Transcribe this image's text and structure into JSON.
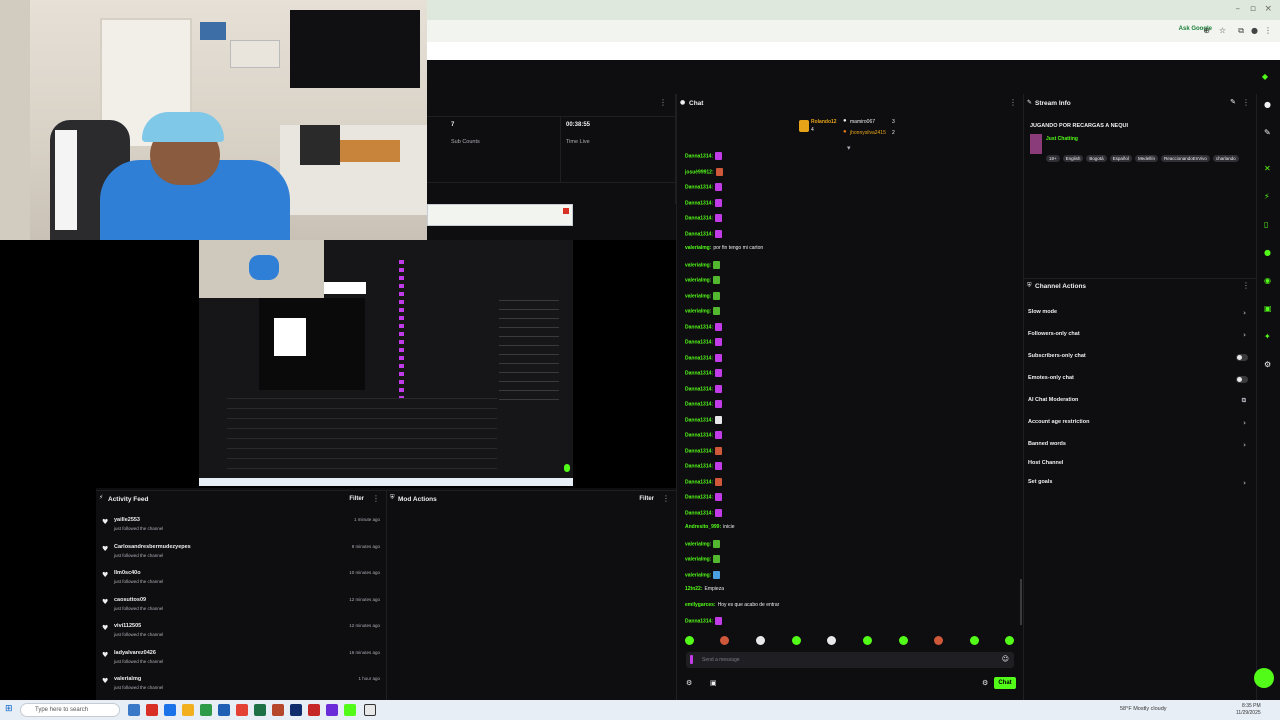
{
  "browser": {
    "ask_google": "Ask Google",
    "window_controls": [
      "–",
      "▫",
      "×"
    ]
  },
  "stats": {
    "sub_count_value": "7",
    "sub_count_label": "Sub Counts",
    "time_live_value": "00:38:55",
    "time_live_label": "Time Live"
  },
  "chat": {
    "title": "Chat",
    "gifters": [
      {
        "name": "Rolando12",
        "count": "4"
      },
      {
        "name": "mamiro067",
        "count": "3"
      },
      {
        "name": "jhonnysilva2415",
        "count": "2"
      }
    ],
    "messages": [
      {
        "user": "Danna1314:",
        "text": "",
        "emote": "e-p"
      },
      {
        "user": "josuè99912:",
        "text": "",
        "emote": "e-o"
      },
      {
        "user": "Danna1314:",
        "text": "",
        "emote": "e-p"
      },
      {
        "user": "Danna1314:",
        "text": "",
        "emote": "e-p"
      },
      {
        "user": "Danna1314:",
        "text": "",
        "emote": "e-p"
      },
      {
        "user": "Danna1314:",
        "text": "",
        "emote": "e-p"
      },
      {
        "user": "valerialmg:",
        "text": "por fin tengo mi carton",
        "emote": ""
      },
      {
        "user": "valerialmg:",
        "text": "",
        "emote": "e-g"
      },
      {
        "user": "valerialmg:",
        "text": "",
        "emote": "e-g"
      },
      {
        "user": "valerialmg:",
        "text": "",
        "emote": "e-g"
      },
      {
        "user": "valerialmg:",
        "text": "",
        "emote": "e-g"
      },
      {
        "user": "Danna1314:",
        "text": "",
        "emote": "e-p"
      },
      {
        "user": "Danna1314:",
        "text": "",
        "emote": "e-p"
      },
      {
        "user": "Danna1314:",
        "text": "",
        "emote": "e-p"
      },
      {
        "user": "Danna1314:",
        "text": "",
        "emote": "e-p"
      },
      {
        "user": "Danna1314:",
        "text": "",
        "emote": "e-p"
      },
      {
        "user": "Danna1314:",
        "text": "",
        "emote": "e-p"
      },
      {
        "user": "Danna1314:",
        "text": "",
        "emote": "e-w"
      },
      {
        "user": "Danna1314:",
        "text": "",
        "emote": "e-p"
      },
      {
        "user": "Danna1314:",
        "text": "",
        "emote": "e-o"
      },
      {
        "user": "Danna1314:",
        "text": "",
        "emote": "e-p"
      },
      {
        "user": "Danna1314:",
        "text": "",
        "emote": "e-o"
      },
      {
        "user": "Danna1314:",
        "text": "",
        "emote": "e-p"
      },
      {
        "user": "Danna1314:",
        "text": "",
        "emote": "e-p"
      },
      {
        "user": "Andresito_999:",
        "text": "inicie",
        "emote": ""
      },
      {
        "user": "valerialmg:",
        "text": "",
        "emote": "e-g"
      },
      {
        "user": "valerialmg:",
        "text": "",
        "emote": "e-g"
      },
      {
        "user": "valerialmg:",
        "text": "",
        "emote": "e-b"
      },
      {
        "user": "12tn22:",
        "text": "Empieza",
        "emote": ""
      },
      {
        "user": "emilygarces:",
        "text": "Hoy es que acabo de entrar",
        "emote": ""
      },
      {
        "user": "Danna1314:",
        "text": "",
        "emote": "e-p"
      }
    ],
    "input_placeholder": "Send a message",
    "send_label": "Chat"
  },
  "stream_info": {
    "title": "Stream Info",
    "stream_title": "JUGANDO POR RECARGAS A NEQUI",
    "category": "Just Chatting",
    "tags": [
      "18+",
      "English",
      "Bogotá",
      "Español",
      "Medellín",
      "ReaccionandoEnVivo",
      "charlando"
    ]
  },
  "channel_actions": {
    "title": "Channel Actions",
    "items": [
      {
        "label": "Slow mode",
        "control": "chevron"
      },
      {
        "label": "Followers-only chat",
        "control": "chevron"
      },
      {
        "label": "Subscribers-only chat",
        "control": "toggle"
      },
      {
        "label": "Emotes-only chat",
        "control": "toggle"
      },
      {
        "label": "AI Chat Moderation",
        "control": "external"
      },
      {
        "label": "Account age restriction",
        "control": "chevron"
      },
      {
        "label": "Banned words",
        "control": "chevron"
      },
      {
        "label": "Host Channel",
        "control": "none"
      },
      {
        "label": "Set goals",
        "control": "chevron"
      }
    ]
  },
  "activity_feed": {
    "title": "Activity Feed",
    "filter_label": "Filter",
    "items": [
      {
        "name": "yaille2553",
        "sub": "just followed the channel",
        "time": "1 minute ago"
      },
      {
        "name": "Carlosandresbermudezyepes",
        "sub": "just followed the channel",
        "time": "8 minutes ago"
      },
      {
        "name": "llm0sc40o",
        "sub": "just followed the channel",
        "time": "10 minutes ago"
      },
      {
        "name": "caosuttos09",
        "sub": "just followed the channel",
        "time": "12 minutes ago"
      },
      {
        "name": "vivi112505",
        "sub": "just followed the channel",
        "time": "12 minutes ago"
      },
      {
        "name": "ladyalvarez0426",
        "sub": "just followed the channel",
        "time": "16 minutes ago"
      },
      {
        "name": "valerialmg",
        "sub": "just followed the channel",
        "time": "1 hour ago"
      }
    ]
  },
  "mod_actions": {
    "title": "Mod Actions",
    "filter_label": "Filter"
  },
  "taskbar": {
    "search_placeholder": "Type here to search",
    "weather": "58°F Mostly cloudy",
    "time": "8:35 PM",
    "date": "11/29/2025"
  },
  "colors": {
    "accent": "#53fc18",
    "background": "#0e0e10",
    "panel_border": "#1f1f23",
    "emote_purple": "#c13be6"
  }
}
